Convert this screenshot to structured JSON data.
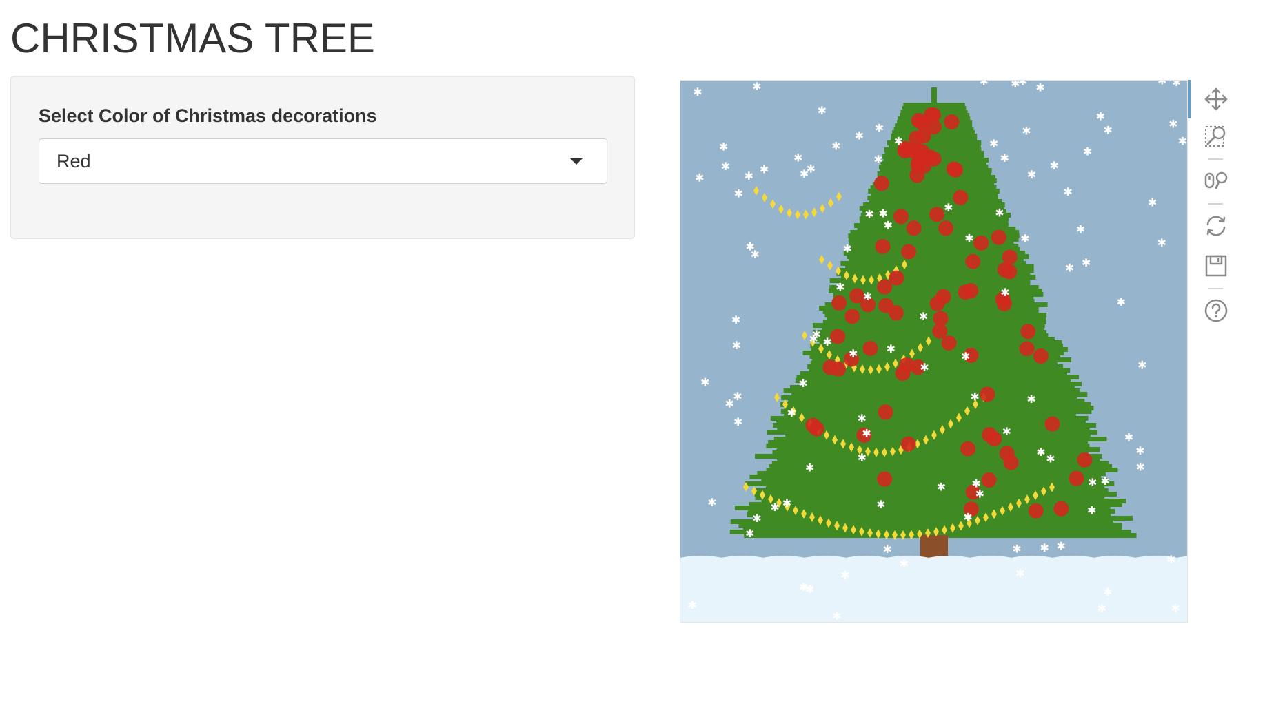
{
  "page": {
    "title": "CHRISTMAS TREE"
  },
  "sidebar": {
    "select_label": "Select Color of Christmas decorations",
    "select_value": "Red"
  },
  "plot": {
    "colors": {
      "sky": "#96b4cc",
      "tree": "#3f8a23",
      "trunk": "#8b4f2a",
      "ornament": "#d1281e",
      "light": "#f4d93a",
      "snow": "#e8f4fc",
      "snowflake": "#ffffff"
    }
  },
  "toolbar": {
    "tools": [
      {
        "name": "pan-tool",
        "icon": "move-arrows-icon",
        "active": true
      },
      {
        "name": "box-zoom-tool",
        "icon": "box-zoom-icon",
        "active": false
      },
      {
        "name": "wheel-zoom-tool",
        "icon": "wheel-zoom-icon",
        "active": false
      },
      {
        "name": "reset-tool",
        "icon": "reset-icon",
        "active": false
      },
      {
        "name": "save-tool",
        "icon": "save-icon",
        "active": false
      },
      {
        "name": "help-tool",
        "icon": "help-icon",
        "active": false
      }
    ]
  }
}
